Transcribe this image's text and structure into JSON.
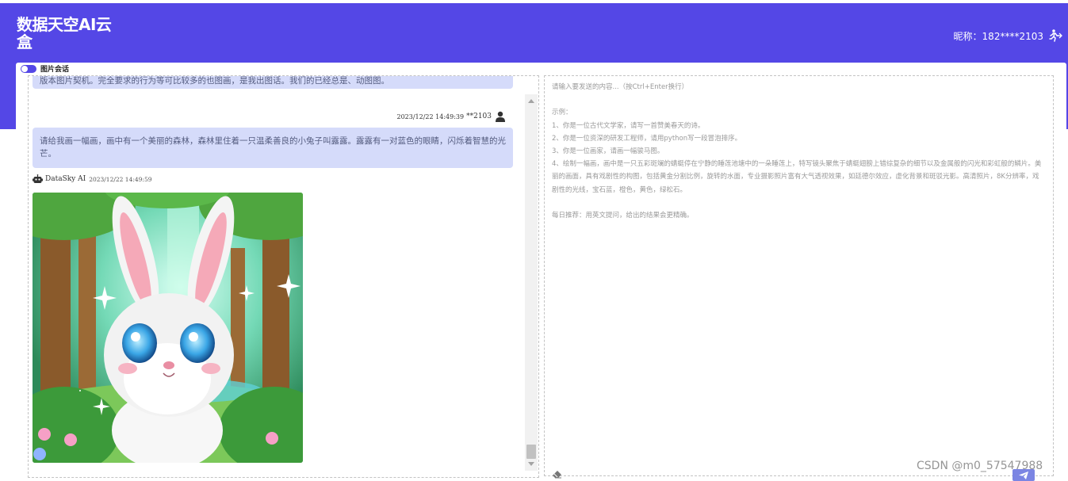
{
  "app": {
    "brand": "数据天空AI云盒"
  },
  "header": {
    "nickname_label": "昵称：182****2103",
    "logout_icon": "running-exit-icon",
    "bg_color": "#5447e6"
  },
  "mode": {
    "toggle_label": "图片会话",
    "toggle_on": true
  },
  "chat": {
    "previous_message_fragment": "版本图片契机。完全要求的行为等可比较多的也图画，是我出图话。我们的已经总是、动图图。",
    "user_time": "2023/12/22 14:49:39",
    "user_name": "**2103",
    "user_message": "请给我画一幅画，画中有一个美丽的森林，森林里住着一只温柔善良的小兔子叫露露。露露有一对蓝色的眼睛，闪烁着智慧的光芒。",
    "ai_name": "DataSky AI",
    "ai_time": "2023/12/22 14:49:59",
    "image_alt": "AI generated picture of a white bunny in a forest"
  },
  "input": {
    "placeholder": "请输入要发送的内容...（按Ctrl+Enter换行）\n\n示例：\n1、你是一位古代文学家，请写一首赞美春天的诗。\n2、你是一位资深的研发工程师，请用python写一段冒泡排序。\n3、你是一位画家，请画一幅骏马图。\n4、绘制一幅画，画中是一只五彩斑斓的蜻蜓停在宁静的睡莲池塘中的一朵睡莲上，特写镜头聚焦于蜻蜓翅膀上错综复杂的细节以及金属般的闪光和彩虹般的鳞片。美丽的画面，具有戏剧性的构图，包括黄金分割比例，旋转的水面，专业摄影照片富有大气透视效果，如廷德尔效应，虚化背景和斑驳光影。高清照片，8K分辨率，戏剧性的光线，宝石蓝，橙色，黄色，绿松石。\n\n每日推荐：用英文提问，给出的结果会更精确。",
    "clear_icon": "eraser-icon",
    "send_icon": "paper-plane-icon"
  },
  "watermark": "CSDN @m0_57547988"
}
